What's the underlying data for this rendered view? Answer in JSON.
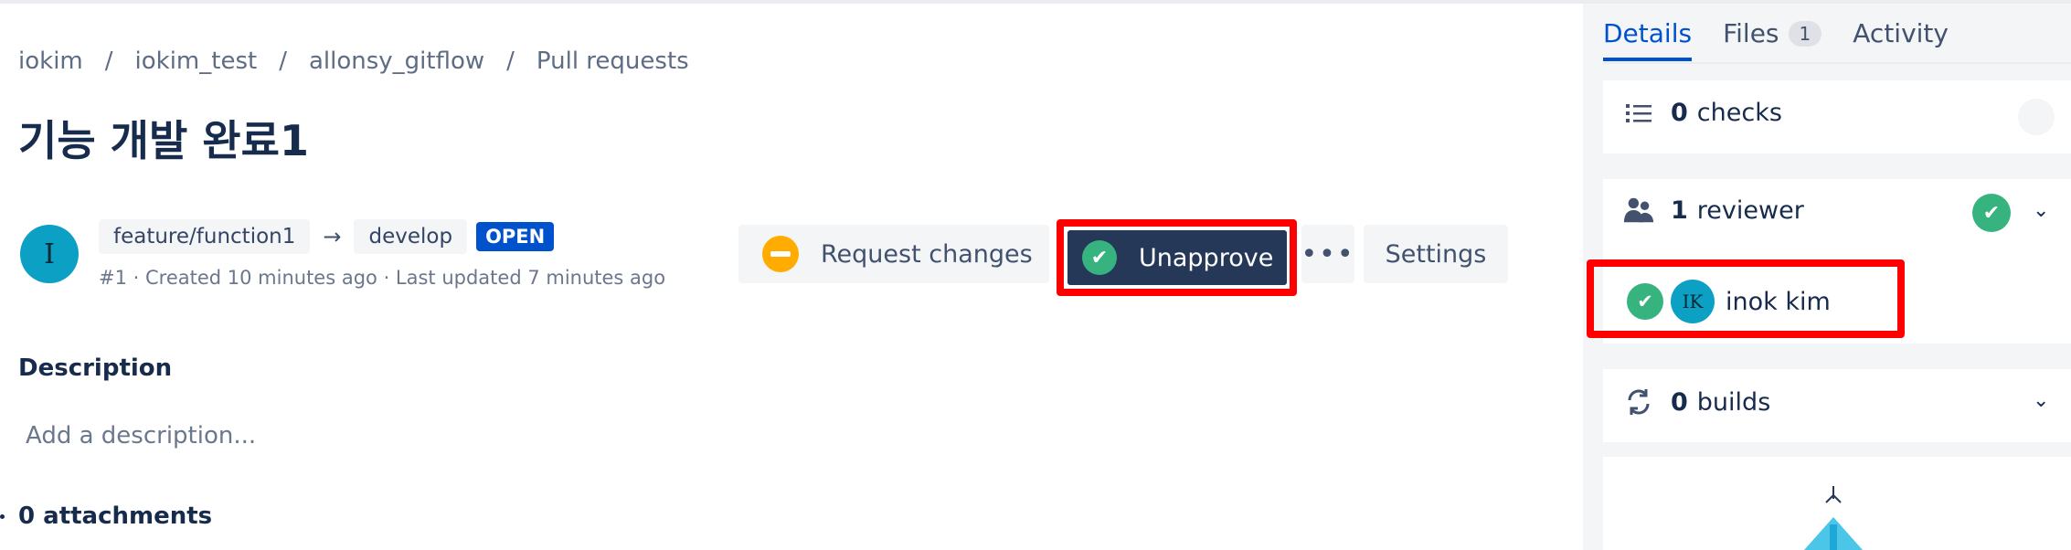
{
  "breadcrumb": [
    "iokim",
    "iokim_test",
    "allonsy_gitflow",
    "Pull requests"
  ],
  "breadcrumb_separator": "/",
  "pr": {
    "title": "기능 개발 완료1",
    "author_initial": "I",
    "source_branch": "feature/function1",
    "target_branch": "develop",
    "state": "OPEN",
    "meta": "#1 · Created 10 minutes ago · Last updated 7 minutes ago"
  },
  "actions": {
    "request_changes": "Request changes",
    "unapprove": "Unapprove",
    "more": "•••",
    "settings": "Settings"
  },
  "description": {
    "heading": "Description",
    "placeholder": "Add a description..."
  },
  "attachments": "0 attachments",
  "sidebar": {
    "tabs": [
      {
        "label": "Details"
      },
      {
        "label": "Files",
        "count": "1"
      },
      {
        "label": "Activity"
      }
    ],
    "checks": {
      "count": "0",
      "label": "checks"
    },
    "reviewers": {
      "count": "1",
      "label": "reviewer",
      "items": [
        {
          "initials": "IK",
          "name": "inok kim"
        }
      ]
    },
    "builds": {
      "count": "0",
      "label": "builds"
    }
  },
  "colors": {
    "primary": "#0052cc",
    "approved": "#36b37e",
    "request_changes": "#ffab00",
    "unapprove_bg": "#253858",
    "highlight": "#ff0000"
  }
}
